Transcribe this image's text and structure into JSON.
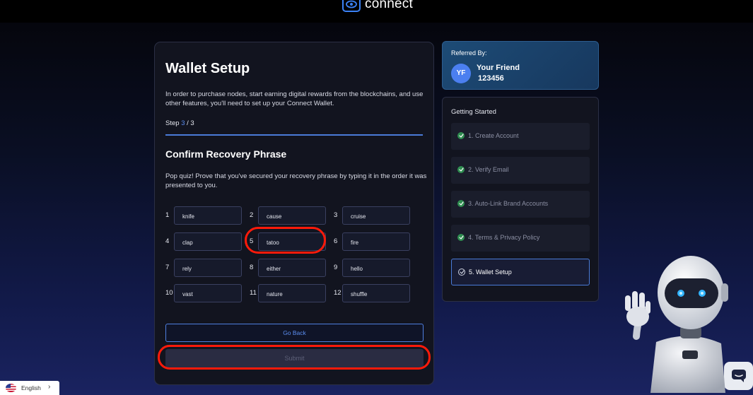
{
  "app": {
    "logo_text": "connect"
  },
  "wallet_setup": {
    "title": "Wallet Setup",
    "intro": "In order to purchase nodes, start earning digital rewards from the blockchains, and use other features, you'll need to set up your Connect Wallet.",
    "step_prefix": "Step ",
    "step_current": "3",
    "step_total": " / 3",
    "progress_fraction": 1.0,
    "section_title": "Confirm Recovery Phrase",
    "quiz_text": "Pop quiz! Prove that you've secured your recovery phrase by typing it in the order it was presented to you.",
    "words": [
      {
        "n": "1",
        "word": "knife"
      },
      {
        "n": "2",
        "word": "cause"
      },
      {
        "n": "3",
        "word": "cruise"
      },
      {
        "n": "4",
        "word": "clap"
      },
      {
        "n": "5",
        "word": "tatoo"
      },
      {
        "n": "6",
        "word": "fire"
      },
      {
        "n": "7",
        "word": "rely"
      },
      {
        "n": "8",
        "word": "either"
      },
      {
        "n": "9",
        "word": "hello"
      },
      {
        "n": "10",
        "word": "vast"
      },
      {
        "n": "11",
        "word": "nature"
      },
      {
        "n": "12",
        "word": "shuffle"
      }
    ],
    "go_back_label": "Go Back",
    "submit_label": "Submit"
  },
  "referral": {
    "label": "Referred By:",
    "initials": "YF",
    "name": "Your Friend",
    "code": "123456"
  },
  "getting_started": {
    "title": "Getting Started",
    "steps": [
      {
        "label": "1. Create Account",
        "status": "done"
      },
      {
        "label": "2. Verify Email",
        "status": "done"
      },
      {
        "label": "3. Auto-Link Brand Accounts",
        "status": "done"
      },
      {
        "label": "4. Terms & Privacy Policy",
        "status": "done"
      },
      {
        "label": "5. Wallet Setup",
        "status": "active"
      }
    ]
  },
  "language": {
    "selected": "English"
  },
  "colors": {
    "accent": "#4a7bd8",
    "highlight": "#ff1a0a",
    "done": "#2f8d50"
  }
}
